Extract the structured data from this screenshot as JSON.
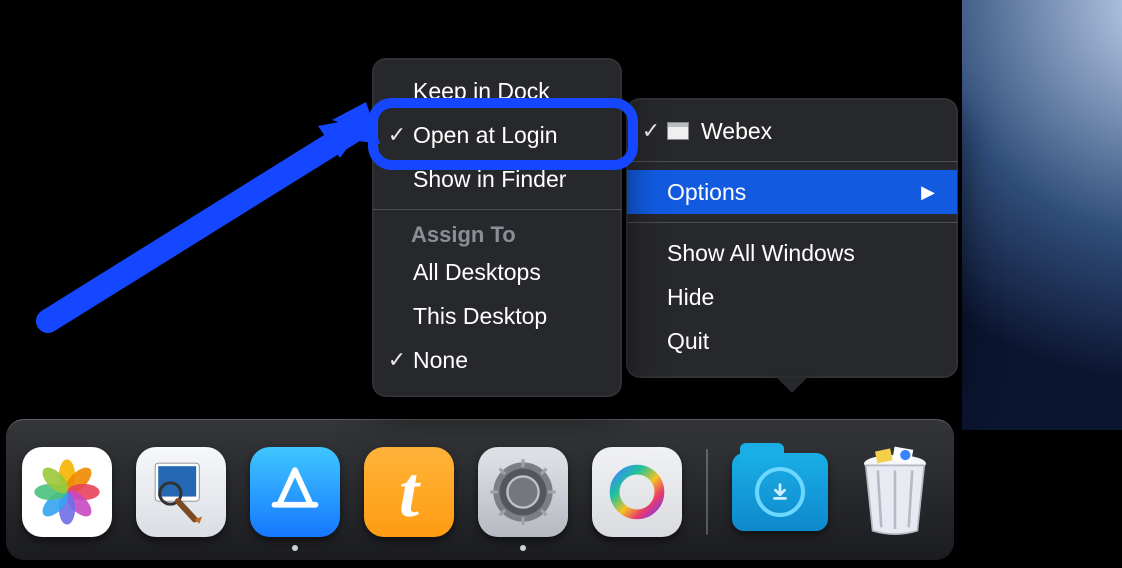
{
  "colors": {
    "highlight": "#1447ff",
    "menu_selected_bg": "#125be0"
  },
  "main_menu": {
    "app_title": "Webex",
    "options_label": "Options",
    "show_all_windows": "Show All Windows",
    "hide": "Hide",
    "quit": "Quit"
  },
  "options_submenu": {
    "keep_in_dock": "Keep in Dock",
    "open_at_login": "Open at Login",
    "open_at_login_checked": true,
    "show_in_finder": "Show in Finder",
    "assign_to_label": "Assign To",
    "all_desktops": "All Desktops",
    "this_desktop": "This Desktop",
    "none": "None",
    "none_checked": true
  },
  "dock": {
    "apps": [
      {
        "name": "Photos"
      },
      {
        "name": "Preview"
      },
      {
        "name": "App Store",
        "running": true
      },
      {
        "name": "Token"
      },
      {
        "name": "System Settings",
        "running": true
      },
      {
        "name": "Webex"
      }
    ],
    "downloads": "Downloads",
    "trash": "Trash"
  },
  "annotation": {
    "highlighted_item": "Open at Login"
  }
}
